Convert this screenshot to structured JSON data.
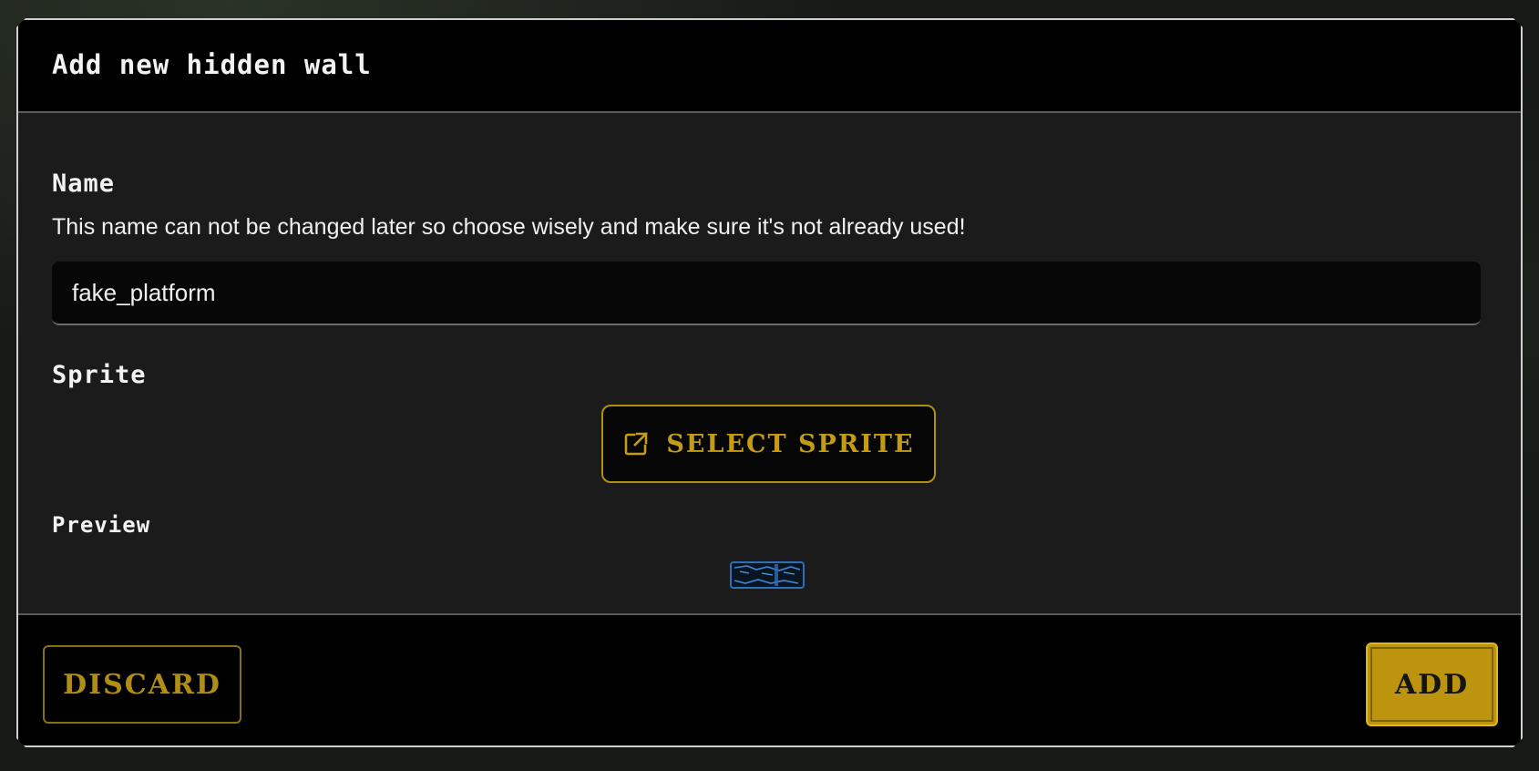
{
  "dialog": {
    "title": "Add new hidden wall",
    "name_label": "Name",
    "name_help": "This name can not be changed later so choose wisely and make sure it's not already used!",
    "name_value": "fake_platform",
    "sprite_label": "Sprite",
    "select_sprite_label": "SELECT SPRITE",
    "preview_label": "Preview"
  },
  "footer": {
    "discard_label": "DISCARD",
    "add_label": "ADD"
  },
  "colors": {
    "accent_gold": "#bc940d",
    "header_bg": "#000000",
    "body_bg": "#1b1b1b",
    "preview_sprite": "#2d6fb8"
  },
  "icons": {
    "select_sprite": "external-link-icon"
  }
}
